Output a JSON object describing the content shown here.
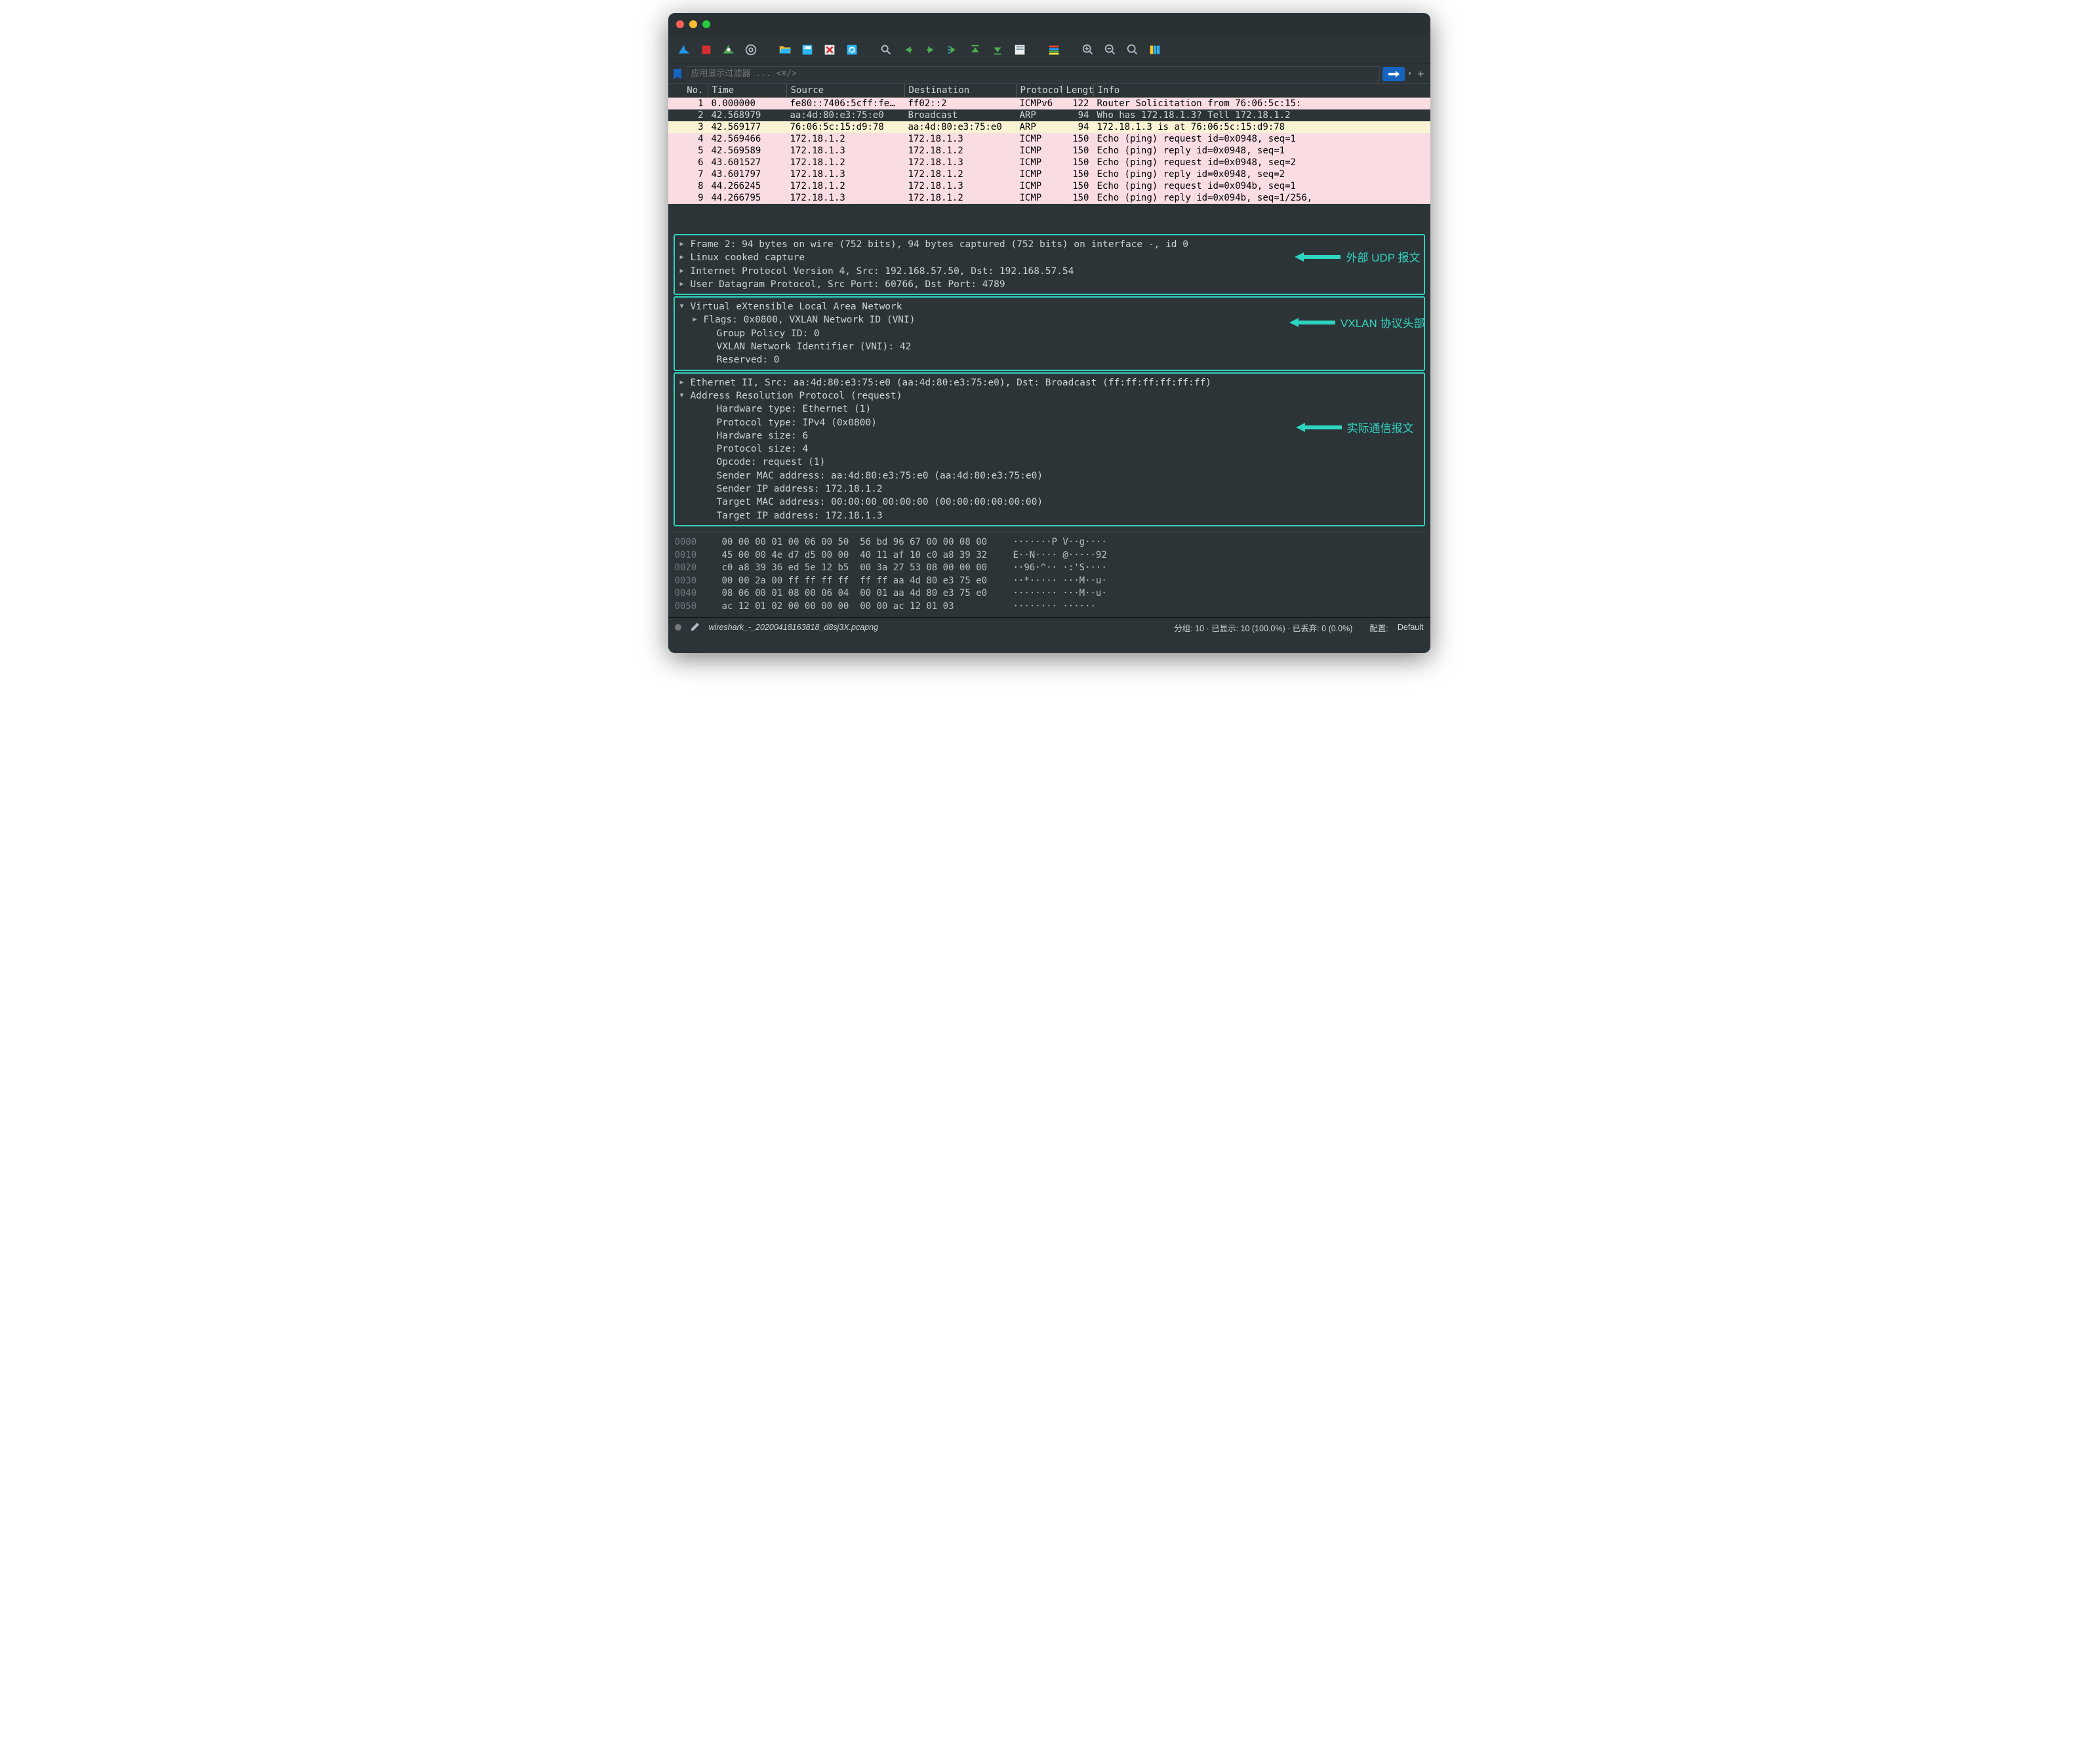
{
  "titlebar": {},
  "filter": {
    "placeholder": "应用显示过滤器 ... <⌘/>"
  },
  "packet_columns": {
    "no": "No.",
    "time": "Time",
    "source": "Source",
    "dest": "Destination",
    "proto": "Protocol",
    "len": "Length",
    "info": "Info"
  },
  "packets": [
    {
      "no": "1",
      "time": "0.000000",
      "src": "fe80::7406:5cff:fe…",
      "dst": "ff02::2",
      "proto": "ICMPv6",
      "len": "122",
      "info": "Router Solicitation from 76:06:5c:15:",
      "cls": "pink"
    },
    {
      "no": "2",
      "time": "42.568979",
      "src": "aa:4d:80:e3:75:e0",
      "dst": "Broadcast",
      "proto": "ARP",
      "len": "94",
      "info": "Who has 172.18.1.3? Tell 172.18.1.2",
      "cls": "selected"
    },
    {
      "no": "3",
      "time": "42.569177",
      "src": "76:06:5c:15:d9:78",
      "dst": "aa:4d:80:e3:75:e0",
      "proto": "ARP",
      "len": "94",
      "info": "172.18.1.3 is at 76:06:5c:15:d9:78",
      "cls": "cream"
    },
    {
      "no": "4",
      "time": "42.569466",
      "src": "172.18.1.2",
      "dst": "172.18.1.3",
      "proto": "ICMP",
      "len": "150",
      "info": "Echo (ping) request  id=0x0948, seq=1",
      "cls": "pink"
    },
    {
      "no": "5",
      "time": "42.569589",
      "src": "172.18.1.3",
      "dst": "172.18.1.2",
      "proto": "ICMP",
      "len": "150",
      "info": "Echo (ping) reply    id=0x0948, seq=1",
      "cls": "pink"
    },
    {
      "no": "6",
      "time": "43.601527",
      "src": "172.18.1.2",
      "dst": "172.18.1.3",
      "proto": "ICMP",
      "len": "150",
      "info": "Echo (ping) request  id=0x0948, seq=2",
      "cls": "pink"
    },
    {
      "no": "7",
      "time": "43.601797",
      "src": "172.18.1.3",
      "dst": "172.18.1.2",
      "proto": "ICMP",
      "len": "150",
      "info": "Echo (ping) reply    id=0x0948, seq=2",
      "cls": "pink"
    },
    {
      "no": "8",
      "time": "44.266245",
      "src": "172.18.1.2",
      "dst": "172.18.1.3",
      "proto": "ICMP",
      "len": "150",
      "info": "Echo (ping) request  id=0x094b, seq=1",
      "cls": "pink"
    },
    {
      "no": "9",
      "time": "44.266795",
      "src": "172.18.1.3",
      "dst": "172.18.1.2",
      "proto": "ICMP",
      "len": "150",
      "info": "Echo (ping) reply    id=0x094b, seq=1/256,",
      "cls": "pink"
    }
  ],
  "tree": {
    "box1": [
      {
        "arrow": "▶",
        "text": "Frame 2: 94 bytes on wire (752 bits), 94 bytes captured (752 bits) on interface -, id 0"
      },
      {
        "arrow": "▶",
        "text": "Linux cooked capture"
      },
      {
        "arrow": "▶",
        "text": "Internet Protocol Version 4, Src: 192.168.57.50, Dst: 192.168.57.54"
      },
      {
        "arrow": "▶",
        "text": "User Datagram Protocol, Src Port: 60766, Dst Port: 4789"
      }
    ],
    "box2_head": {
      "arrow": "▼",
      "text": "Virtual eXtensible Local Area Network"
    },
    "box2": [
      {
        "arrow": "▶",
        "indent": 1,
        "text": "Flags: 0x0800, VXLAN Network ID (VNI)"
      },
      {
        "indent": 2,
        "text": "Group Policy ID: 0"
      },
      {
        "indent": 2,
        "text": "VXLAN Network Identifier (VNI): 42"
      },
      {
        "indent": 2,
        "text": "Reserved: 0"
      }
    ],
    "box3": [
      {
        "arrow": "▶",
        "text": "Ethernet II, Src: aa:4d:80:e3:75:e0 (aa:4d:80:e3:75:e0), Dst: Broadcast (ff:ff:ff:ff:ff:ff)"
      },
      {
        "arrow": "▼",
        "text": "Address Resolution Protocol (request)"
      },
      {
        "indent": 2,
        "text": "Hardware type: Ethernet (1)"
      },
      {
        "indent": 2,
        "text": "Protocol type: IPv4 (0x0800)"
      },
      {
        "indent": 2,
        "text": "Hardware size: 6"
      },
      {
        "indent": 2,
        "text": "Protocol size: 4"
      },
      {
        "indent": 2,
        "text": "Opcode: request (1)"
      },
      {
        "indent": 2,
        "text": "Sender MAC address: aa:4d:80:e3:75:e0 (aa:4d:80:e3:75:e0)"
      },
      {
        "indent": 2,
        "text": "Sender IP address: 172.18.1.2"
      },
      {
        "indent": 2,
        "text": "Target MAC address: 00:00:00_00:00:00 (00:00:00:00:00:00)"
      },
      {
        "indent": 2,
        "text": "Target IP address: 172.18.1.3"
      }
    ]
  },
  "callouts": {
    "outer": "外部 UDP 报文",
    "vxlan": "VXLAN 协议头部",
    "actual": "实际通信报文"
  },
  "hex": [
    {
      "off": "0000",
      "b": "00 00 00 01 00 06 00 50  56 bd 96 67 00 00 08 00",
      "a": "·······P V··g····"
    },
    {
      "off": "0010",
      "b": "45 00 00 4e d7 d5 00 00  40 11 af 10 c0 a8 39 32",
      "a": "E··N···· @·····92"
    },
    {
      "off": "0020",
      "b": "c0 a8 39 36 ed 5e 12 b5  00 3a 27 53 08 00 00 00",
      "a": "··96·^·· ·:'S····"
    },
    {
      "off": "0030",
      "b": "00 00 2a 00 ff ff ff ff  ff ff aa 4d 80 e3 75 e0",
      "a": "··*····· ···M··u·"
    },
    {
      "off": "0040",
      "b": "08 06 00 01 08 00 06 04  00 01 aa 4d 80 e3 75 e0",
      "a": "········ ···M··u·"
    },
    {
      "off": "0050",
      "b": "ac 12 01 02 00 00 00 00  00 00 ac 12 01 03",
      "a": "········ ······"
    }
  ],
  "status": {
    "file": "wireshark_-_20200418163818_d8sj3X.pcapng",
    "stats": "分组: 10 · 已显示: 10 (100.0%) · 已丢弃: 0 (0.0%)",
    "profile_label": "配置:",
    "profile": "Default"
  }
}
